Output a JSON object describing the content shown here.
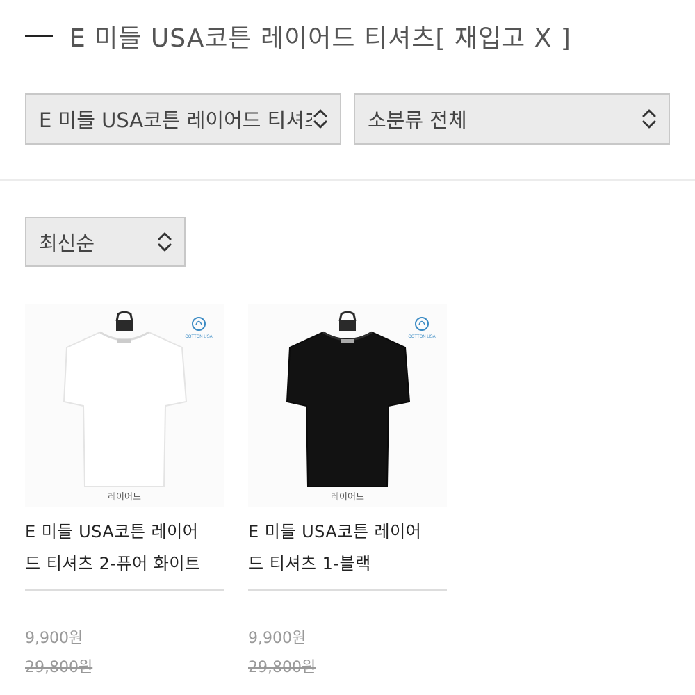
{
  "header": {
    "title": "E 미들 USA코튼 레이어드 티셔츠[ 재입고 X ]"
  },
  "filters": {
    "category": "E 미들 USA코튼 레이어드 티셔츠[ 재입고 X ]",
    "subcategory": "소분류 전체",
    "sort": "최신순"
  },
  "products": [
    {
      "brand": "레이어드",
      "name_line1": "E 미들 USA코튼 레이어",
      "name_line2": "드 티셔츠 2-퓨어 화이트",
      "sale_price": "9,900원",
      "original_price": "29,800원",
      "shirt_color": "#ffffff",
      "badge_text": "COTTON USA"
    },
    {
      "brand": "레이어드",
      "name_line1": "E 미들 USA코튼 레이어",
      "name_line2": "드 티셔츠 1-블랙",
      "sale_price": "9,900원",
      "original_price": "29,800원",
      "shirt_color": "#121212",
      "badge_text": "COTTON USA"
    }
  ],
  "colors": {
    "select_background": "#ebebeb",
    "select_border": "#c8c8c8",
    "price_gray": "#999999"
  }
}
